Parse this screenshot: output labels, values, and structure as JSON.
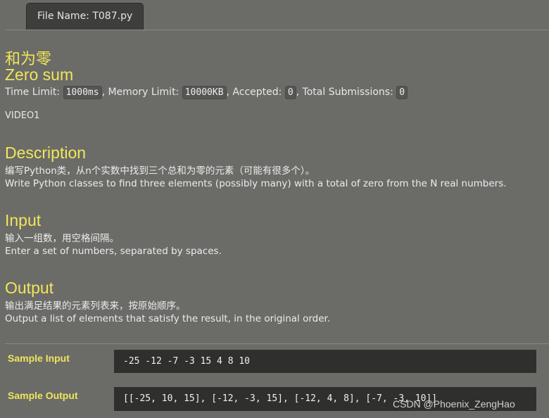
{
  "tab": {
    "label": "File Name:  T087.py"
  },
  "problem": {
    "title_cn": "和为零",
    "title_en": "Zero sum",
    "limits": {
      "time_label": "Time Limit:",
      "time_value": "1000ms",
      "memory_label": ", Memory Limit:",
      "memory_value": "10000KB",
      "accepted_label": ", Accepted:",
      "accepted_value": "0",
      "submissions_label": ", Total Submissions:",
      "submissions_value": "0"
    },
    "video_tag": "VIDEO1"
  },
  "description": {
    "heading": "Description",
    "line_cn": "编写Python类，从n个实数中找到三个总和为零的元素（可能有很多个）。",
    "line_en": "Write Python classes to find three elements (possibly many) with a total of zero from the N real numbers."
  },
  "input": {
    "heading": "Input",
    "line_cn": "输入一组数，用空格间隔。",
    "line_en": "Enter a set of numbers, separated by spaces."
  },
  "output": {
    "heading": "Output",
    "line_cn": "输出满足结果的元素列表来，按原始顺序。",
    "line_en": "Output a list of elements that satisfy the result, in the original order."
  },
  "sample_input": {
    "label": "Sample Input",
    "value": "-25 -12 -7 -3 15 4 8 10"
  },
  "sample_output": {
    "label": "Sample Output",
    "value": "[[-25, 10, 15], [-12, -3, 15], [-12, 4, 8], [-7, -3, 10]]"
  },
  "watermark": "CSDN @Phoenix_ZengHao"
}
